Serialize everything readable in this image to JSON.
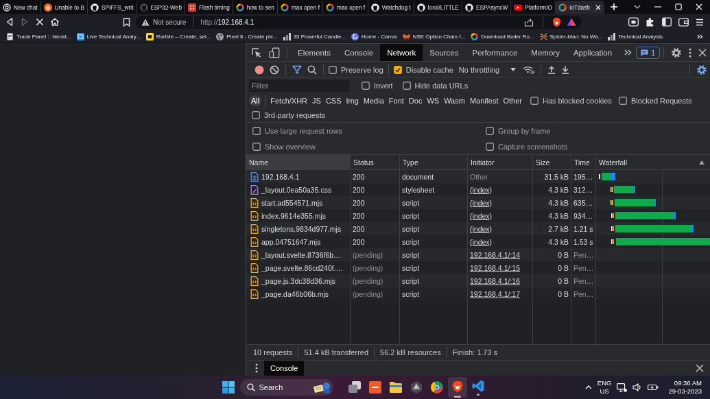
{
  "browser": {
    "tabs": [
      {
        "title": "New chat",
        "kind": "swirl",
        "selected": false
      },
      {
        "title": "Unable to B",
        "kind": "circle",
        "selected": false
      },
      {
        "title": "SPIFFS_writ",
        "kind": "github",
        "selected": false
      },
      {
        "title": "ESP32-Web",
        "kind": "github-dim",
        "selected": false
      },
      {
        "title": "Flash timing",
        "kind": "tile",
        "selected": false
      },
      {
        "title": "how to sen",
        "kind": "google",
        "selected": false
      },
      {
        "title": "max open f",
        "kind": "google",
        "selected": false
      },
      {
        "title": "max open f",
        "kind": "google",
        "selected": false
      },
      {
        "title": "Watchdog t",
        "kind": "github",
        "selected": false
      },
      {
        "title": "lorol/LITTLE",
        "kind": "github",
        "selected": false
      },
      {
        "title": "ESPAsyncW",
        "kind": "github",
        "selected": false
      },
      {
        "title": "PlatformIO",
        "kind": "video",
        "selected": false
      },
      {
        "title": "IoTdash",
        "kind": "spinner",
        "selected": true
      }
    ],
    "forward_disabled": true,
    "address": {
      "security": "Not secure",
      "scheme": "http://",
      "host": "192.168.4.1"
    },
    "bookmarks": [
      {
        "title": "Trade Panel :: Neost...",
        "kind": "page"
      },
      {
        "title": "Live Technical Analy...",
        "kind": "square"
      },
      {
        "title": "Rarible – Create, sel...",
        "kind": "badge"
      },
      {
        "title": "Pixel It - Create pix...",
        "kind": "globe"
      },
      {
        "title": "35 Powerful Candle...",
        "kind": "chart"
      },
      {
        "title": "Home - Canva",
        "kind": "disc"
      },
      {
        "title": "NSE Option Chain f...",
        "kind": "bull"
      },
      {
        "title": "Download Boiler Ro...",
        "kind": "google"
      },
      {
        "title": "Spider-Man: No Wa...",
        "kind": "spider"
      },
      {
        "title": "Technical Analysis",
        "kind": "chart"
      }
    ]
  },
  "devtools": {
    "panel_tabs": [
      {
        "label": "Elements",
        "selected": false
      },
      {
        "label": "Console",
        "selected": false
      },
      {
        "label": "Network",
        "selected": true
      },
      {
        "label": "Sources",
        "selected": false
      },
      {
        "label": "Performance",
        "selected": false
      },
      {
        "label": "Memory",
        "selected": false
      },
      {
        "label": "Application",
        "selected": false
      }
    ],
    "issues_count": "1",
    "toolbar": {
      "recording": true,
      "preserve_log": {
        "label": "Preserve log",
        "checked": false
      },
      "disable_cache": {
        "label": "Disable cache",
        "checked": true
      },
      "throttling": "No throttling"
    },
    "filter": {
      "placeholder": "Filter",
      "options": [
        {
          "label": "Invert",
          "checked": false
        },
        {
          "label": "Hide data URLs",
          "checked": false
        }
      ]
    },
    "types": [
      {
        "label": "All",
        "selected": true
      },
      {
        "label": "Fetch/XHR",
        "selected": false
      },
      {
        "label": "JS",
        "selected": false
      },
      {
        "label": "CSS",
        "selected": false
      },
      {
        "label": "Img",
        "selected": false
      },
      {
        "label": "Media",
        "selected": false
      },
      {
        "label": "Font",
        "selected": false
      },
      {
        "label": "Doc",
        "selected": false
      },
      {
        "label": "WS",
        "selected": false
      },
      {
        "label": "Wasm",
        "selected": false
      },
      {
        "label": "Manifest",
        "selected": false
      },
      {
        "label": "Other",
        "selected": false
      }
    ],
    "type_options": [
      {
        "label": "Has blocked cookies",
        "checked": false
      },
      {
        "label": "Blocked Requests",
        "checked": false
      }
    ],
    "third_party": {
      "label": "3rd-party requests",
      "checked": false
    },
    "settings": [
      {
        "label": "Use large request rows",
        "checked": false
      },
      {
        "label": "Group by frame",
        "checked": false
      },
      {
        "label": "Show overview",
        "checked": false
      },
      {
        "label": "Capture screenshots",
        "checked": false
      }
    ],
    "columns": [
      {
        "label": "Name",
        "highlighted": true,
        "sorted": false
      },
      {
        "label": "Status",
        "highlighted": false,
        "sorted": false
      },
      {
        "label": "Type",
        "highlighted": false,
        "sorted": false
      },
      {
        "label": "Initiator",
        "highlighted": false,
        "sorted": false
      },
      {
        "label": "Size",
        "highlighted": false,
        "sorted": false
      },
      {
        "label": "Time",
        "highlighted": false,
        "sorted": false
      },
      {
        "label": "Waterfall",
        "highlighted": false,
        "sorted": true
      }
    ],
    "requests": [
      {
        "name": "192.168.4.1",
        "kind": "document",
        "status": "200",
        "type": "document",
        "initiator": "Other",
        "initiator_link": false,
        "size": "31.5 kB",
        "time": "195…",
        "pending": false
      },
      {
        "name": "_layout.0ea50a35.css",
        "kind": "stylesheet",
        "status": "200",
        "type": "stylesheet",
        "initiator": "(index)",
        "initiator_link": true,
        "size": "4.3 kB",
        "time": "312…",
        "pending": false
      },
      {
        "name": "start.ad554571.mjs",
        "kind": "script",
        "status": "200",
        "type": "script",
        "initiator": "(index)",
        "initiator_link": true,
        "size": "4.3 kB",
        "time": "635…",
        "pending": false
      },
      {
        "name": "index.9614e355.mjs",
        "kind": "script",
        "status": "200",
        "type": "script",
        "initiator": "(index)",
        "initiator_link": true,
        "size": "4.3 kB",
        "time": "934…",
        "pending": false
      },
      {
        "name": "singletons.9834d977.mjs",
        "kind": "script",
        "status": "200",
        "type": "script",
        "initiator": "(index)",
        "initiator_link": true,
        "size": "2.7 kB",
        "time": "1.21 s",
        "pending": false
      },
      {
        "name": "app.04751647.mjs",
        "kind": "script",
        "status": "200",
        "type": "script",
        "initiator": "(index)",
        "initiator_link": true,
        "size": "4.3 kB",
        "time": "1.53 s",
        "pending": false
      },
      {
        "name": "_layout.svelte.8736f6b…",
        "kind": "script",
        "status": "(pending)",
        "type": "script",
        "initiator": "192.168.4.1/:14",
        "initiator_link": true,
        "size": "0 B",
        "time": "Pen…",
        "pending": true
      },
      {
        "name": "_page.svelte.86cd240f.…",
        "kind": "script",
        "status": "(pending)",
        "type": "script",
        "initiator": "192.168.4.1/:15",
        "initiator_link": true,
        "size": "0 B",
        "time": "Pen…",
        "pending": true
      },
      {
        "name": "_page.js.3dc38d36.mjs",
        "kind": "script",
        "status": "(pending)",
        "type": "script",
        "initiator": "192.168.4.1/:16",
        "initiator_link": true,
        "size": "0 B",
        "time": "Pen…",
        "pending": true
      },
      {
        "name": "_page.da46b06b.mjs",
        "kind": "script",
        "status": "(pending)",
        "type": "script",
        "initiator": "192.168.4.1/:17",
        "initiator_link": true,
        "size": "0 B",
        "time": "Pen…",
        "pending": true
      }
    ],
    "summary": [
      "10 requests",
      "51.4 kB transferred",
      "56.2 kB resources",
      "Finish: 1.73 s"
    ],
    "drawer_tabs": [
      {
        "label": "Console",
        "selected": true
      }
    ]
  },
  "taskbar": {
    "search_label": "Search",
    "apps": [
      {
        "kind": "stack",
        "selected": false,
        "running": false
      },
      {
        "kind": "tile",
        "selected": false,
        "running": false
      },
      {
        "kind": "folder",
        "selected": false,
        "running": false
      },
      {
        "kind": "hexagon",
        "selected": false,
        "running": false
      },
      {
        "kind": "ring",
        "selected": false,
        "running": false
      },
      {
        "kind": "lion",
        "selected": true,
        "running": true
      },
      {
        "kind": "ribbon",
        "selected": false,
        "running": true
      }
    ],
    "language": "ENG",
    "region": "US",
    "time": "09:36 AM",
    "date": "29-03-2023"
  }
}
